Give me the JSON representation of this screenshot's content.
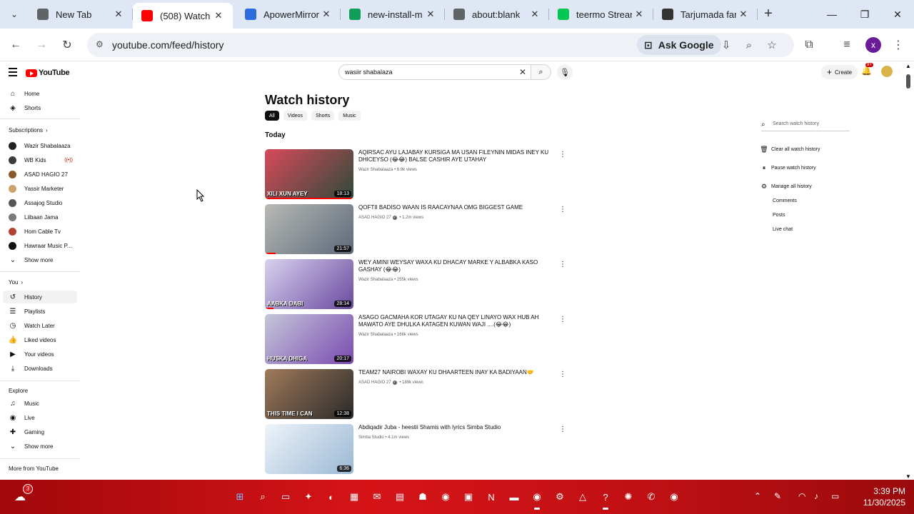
{
  "browser": {
    "tabs": [
      {
        "title": "New Tab",
        "icon": "chrome-icon",
        "color": "#5f6368",
        "active": false
      },
      {
        "title": "(508) Watch h",
        "icon": "youtube-icon",
        "color": "#ff0000",
        "active": true
      },
      {
        "title": "ApowerMirror",
        "icon": "apowermirror-icon",
        "color": "#2d6cdf",
        "active": false
      },
      {
        "title": "new-install-m",
        "icon": "edge-icon",
        "color": "#0f9d58",
        "active": false
      },
      {
        "title": "about:blank",
        "icon": "globe-icon",
        "color": "#5f6368",
        "active": false
      },
      {
        "title": "teermo Strean",
        "icon": "kick-icon",
        "color": "#00c853",
        "active": false
      },
      {
        "title": "Tarjumada fan",
        "icon": "chatgpt-icon",
        "color": "#333333",
        "active": false
      }
    ],
    "url": "youtube.com/feed/history",
    "ask_google": "Ask Google",
    "profile_initial": "x"
  },
  "youtube": {
    "logo": "YouTube",
    "search_query": "wasiir shabalaza",
    "create_label": "Create",
    "notification_count": "9+",
    "sidebar": {
      "top": [
        {
          "label": "Home",
          "icon": "home-icon"
        },
        {
          "label": "Shorts",
          "icon": "shorts-icon"
        }
      ],
      "subscriptions_header": "Subscriptions",
      "subscriptions": [
        {
          "label": "Wazir Shabalaaza",
          "color": "#222222",
          "live": false
        },
        {
          "label": "WB Kids",
          "color": "#3b3b3b",
          "live": true
        },
        {
          "label": "ASAD HAGIO 27",
          "color": "#8a5a2b",
          "live": false
        },
        {
          "label": "Yassir Marketer",
          "color": "#c9a36a",
          "live": false
        },
        {
          "label": "Assajog Studio",
          "color": "#555555",
          "live": false
        },
        {
          "label": "Liibaan Jama",
          "color": "#7a7a7a",
          "live": false
        },
        {
          "label": "Hom Cable Tv",
          "color": "#b5442e",
          "live": false
        },
        {
          "label": "Hawraar Music P...",
          "color": "#111111",
          "live": false
        }
      ],
      "show_more": "Show more",
      "you_header": "You",
      "you": [
        {
          "label": "History",
          "icon": "history-icon",
          "selected": true
        },
        {
          "label": "Playlists",
          "icon": "playlists-icon",
          "selected": false
        },
        {
          "label": "Watch Later",
          "icon": "clock-icon",
          "selected": false
        },
        {
          "label": "Liked videos",
          "icon": "thumbs-up-icon",
          "selected": false
        },
        {
          "label": "Your videos",
          "icon": "video-icon",
          "selected": false
        },
        {
          "label": "Downloads",
          "icon": "download-icon",
          "selected": false
        }
      ],
      "explore_header": "Explore",
      "explore": [
        {
          "label": "Music",
          "icon": "music-icon"
        },
        {
          "label": "Live",
          "icon": "live-icon"
        },
        {
          "label": "Gaming",
          "icon": "gaming-icon"
        }
      ],
      "show_more_2": "Show more",
      "more_header": "More from YouTube"
    },
    "page_title": "Watch history",
    "chips": [
      "All",
      "Videos",
      "Shorts",
      "Music"
    ],
    "section": "Today",
    "videos": [
      {
        "title": "AQIRSAC AYU LAJABAY KURSIGA MA USAN FILEYNIN MIDAS INEY KU DHICEYSO (😂😂) BALSE CASHIR AYE UTAHAY",
        "channel": "Wazir Shabalaaza",
        "views": "6.9k views",
        "verified": false,
        "duration": "18:13",
        "caption": "XILI XUN AYEY",
        "progress": 1.0,
        "thumb_a": "#d84a5a",
        "thumb_b": "#2e4a3a"
      },
      {
        "title": "QOFTII BADISO WAAN IS RAACAYNAA OMG BIGGEST GAME",
        "channel": "ASAD HAGIO 27",
        "views": "1.2m views",
        "verified": true,
        "duration": "21:57",
        "caption": "",
        "progress": 0.12,
        "thumb_a": "#b7b9b4",
        "thumb_b": "#5e6a7a"
      },
      {
        "title": "WEY AMINI WEYSAY WAXA KU DHACAY  MARKE Y ALBABKA KASO GASHAY (😂😂)",
        "channel": "Wazir Shabalaaza",
        "views": "255k views",
        "verified": false,
        "duration": "28:14",
        "caption": "AABKA DABI",
        "progress": 0.1,
        "thumb_a": "#d8d2ee",
        "thumb_b": "#6a4aa0"
      },
      {
        "title": "ASAGO GACMAHA KOR UTAGAY KU NA QEY LINAYO WAX HUB AH MAWATO AYE DHULKA KATAGEN KUWAN WAJI ....(😂😂)",
        "channel": "Wazir Shabalaaza",
        "views": "166k views",
        "verified": false,
        "duration": "20:17",
        "caption": "HUSKA DHIGA",
        "progress": 0.0,
        "thumb_a": "#c4c7d8",
        "thumb_b": "#7a4ab0"
      },
      {
        "title": "TEAM27 NAIROBI WAXAY KU DHAARTEEN INAY KA BADIYAAN🤝",
        "channel": "ASAD HAGIO 27",
        "views": "189k views",
        "verified": true,
        "duration": "12:38",
        "caption": "THIS TIME I CAN",
        "progress": 0.0,
        "thumb_a": "#a07a5a",
        "thumb_b": "#2a2a2a"
      },
      {
        "title": "Abdiqadir Juba - heestii Shamis with lyrics Simba Studio",
        "channel": "Simba Studio",
        "views": "4.1m views",
        "verified": false,
        "duration": "6:36",
        "caption": "",
        "progress": 0.0,
        "thumb_a": "#eef4fa",
        "thumb_b": "#9ab8d4"
      }
    ],
    "right_panel": {
      "search_placeholder": "Search watch history",
      "clear": "Clear all watch history",
      "pause": "Pause watch history",
      "manage": "Manage all history",
      "subs": [
        "Comments",
        "Posts",
        "Live chat"
      ]
    }
  },
  "taskbar": {
    "weather_badge": "3",
    "time": "3:39 PM",
    "date": "11/30/2025"
  }
}
